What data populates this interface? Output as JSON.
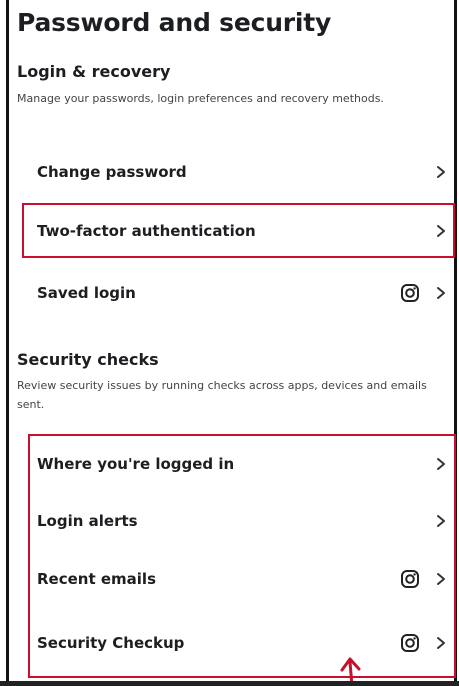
{
  "header": {
    "title": "Password and security"
  },
  "login_recovery": {
    "title": "Login & recovery",
    "description": "Manage your passwords, login preferences and recovery methods.",
    "items": [
      {
        "label": "Change password",
        "icon": "chevron-right-icon"
      },
      {
        "label": "Two-factor authentication",
        "icon": "chevron-right-icon",
        "highlighted": true
      },
      {
        "label": "Saved login",
        "icon": "chevron-right-icon",
        "badge_icon": "instagram-icon"
      }
    ]
  },
  "security_checks": {
    "title": "Security checks",
    "description": "Review security issues by running checks across apps, devices and emails sent.",
    "items": [
      {
        "label": "Where you're logged in",
        "icon": "chevron-right-icon"
      },
      {
        "label": "Login alerts",
        "icon": "chevron-right-icon"
      },
      {
        "label": "Recent emails",
        "icon": "chevron-right-icon",
        "badge_icon": "instagram-icon"
      },
      {
        "label": "Security Checkup",
        "icon": "chevron-right-icon",
        "badge_icon": "instagram-icon"
      }
    ]
  },
  "annotation": {
    "highlight_color": "#c8102e"
  }
}
